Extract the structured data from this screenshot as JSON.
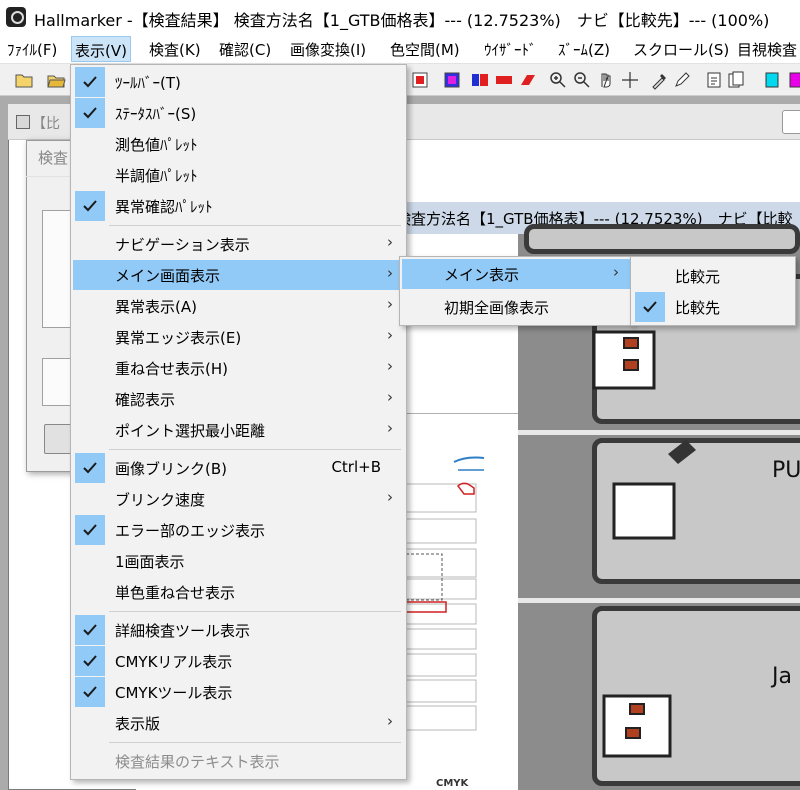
{
  "window": {
    "title": "Hallmarker -【検査結果】 検査方法名【1_GTB価格表】--- (12.7523%)　ナビ【比較先】--- (100%)"
  },
  "menubar": [
    {
      "label": "ﾌｧｲﾙ(F)",
      "id": "file"
    },
    {
      "label": "表示(V)",
      "id": "view"
    },
    {
      "label": "検査(K)",
      "id": "inspect"
    },
    {
      "label": "確認(C)",
      "id": "confirm"
    },
    {
      "label": "画像変換(I)",
      "id": "image-convert"
    },
    {
      "label": "色空間(M)",
      "id": "color-space"
    },
    {
      "label": "ｳｲｻﾞｰﾄﾞ",
      "id": "wizard"
    },
    {
      "label": "ｽﾞｰﾑ(Z)",
      "id": "zoom"
    },
    {
      "label": "スクロール(S)",
      "id": "scroll"
    },
    {
      "label": "目視検査",
      "id": "visual-inspect"
    }
  ],
  "toolbar": {
    "icons": [
      "open-icon",
      "open-folder-icon",
      "red-square-icon",
      "magenta-square-icon",
      "red-blue-icon",
      "red-dash-icon",
      "red-shape-icon",
      "zoom-in-icon",
      "zoom-out-icon",
      "hand-icon",
      "crosshair-icon",
      "eyedropper-icon",
      "pen-icon",
      "page-a-icon",
      "page-b-icon",
      "cyan-page-icon",
      "magenta-page-icon"
    ]
  },
  "child_window": {
    "title_partial": "【比",
    "dialog_title_partial": "検査"
  },
  "result_window": {
    "title": "検査方法名【1_GTB価格表】--- (12.7523%)　ナビ【比較"
  },
  "view_menu": {
    "items": [
      {
        "label": "ﾂｰﾙﾊﾞｰ(T)",
        "checked": true
      },
      {
        "label": "ｽﾃｰﾀｽﾊﾞｰ(S)",
        "checked": true
      },
      {
        "label": "測色値ﾊﾟﾚｯﾄ",
        "checked": false
      },
      {
        "label": "半調値ﾊﾟﾚｯﾄ",
        "checked": false
      },
      {
        "label": "異常確認ﾊﾟﾚｯﾄ",
        "checked": true
      },
      {
        "label": "ナビゲーション表示",
        "submenu": true
      },
      {
        "label": "メイン画面表示",
        "submenu": true,
        "highlighted": true
      },
      {
        "label": "異常表示(A)",
        "submenu": true
      },
      {
        "label": "異常エッジ表示(E)",
        "submenu": true
      },
      {
        "label": "重ね合せ表示(H)",
        "submenu": true
      },
      {
        "label": "確認表示",
        "submenu": true
      },
      {
        "label": "ポイント選択最小距離",
        "submenu": true
      },
      {
        "label": "画像ブリンク(B)",
        "checked": true,
        "shortcut": "Ctrl+B"
      },
      {
        "label": "ブリンク速度",
        "submenu": true
      },
      {
        "label": "エラー部のエッジ表示",
        "checked": true
      },
      {
        "label": "1画面表示",
        "checked": false
      },
      {
        "label": "単色重ね合せ表示",
        "checked": false
      },
      {
        "label": "詳細検査ツール表示",
        "checked": true
      },
      {
        "label": "CMYKリアル表示",
        "checked": true
      },
      {
        "label": "CMYKツール表示",
        "checked": true
      },
      {
        "label": "表示版",
        "submenu": true
      },
      {
        "label": "検査結果のテキスト表示",
        "disabled": true
      }
    ]
  },
  "main_display_submenu": {
    "items": [
      {
        "label": "メイン表示",
        "submenu": true,
        "highlighted": true
      },
      {
        "label": "初期全画像表示"
      }
    ]
  },
  "main_view_submenu": {
    "items": [
      {
        "label": "比較元",
        "checked": false
      },
      {
        "label": "比較先",
        "checked": true
      }
    ]
  },
  "scan_panel": {
    "text_partial": [
      "PU",
      "Ja"
    ]
  },
  "colors": {
    "menu_highlight": "#91c9f7",
    "menu_bg": "#f2f2f2",
    "menubar_open": "#cce4f7",
    "check_bg": "#91c9f7"
  }
}
